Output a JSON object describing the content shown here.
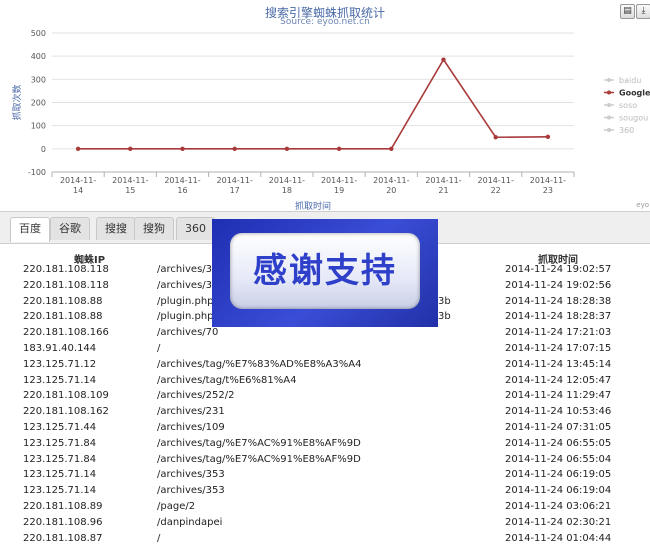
{
  "chart_data": {
    "type": "line",
    "title": "搜索引擎蜘蛛抓取统计",
    "subtitle": "Source: eyoo.net.cn",
    "xlabel": "抓取时间",
    "ylabel": "抓取次数",
    "categories": [
      "2014-11-14",
      "2014-11-15",
      "2014-11-16",
      "2014-11-17",
      "2014-11-18",
      "2014-11-19",
      "2014-11-20",
      "2014-11-21",
      "2014-11-22",
      "2014-11-23"
    ],
    "yticks": [
      -100,
      0,
      100,
      200,
      300,
      400,
      500
    ],
    "ylim": [
      -100,
      500
    ],
    "grid": true,
    "legend_position": "right",
    "series": [
      {
        "name": "baidu",
        "color": "#c8c8c8",
        "values": []
      },
      {
        "name": "Google",
        "color": "#a83a3a",
        "values": [
          0,
          0,
          0,
          0,
          0,
          0,
          0,
          385,
          50,
          52
        ]
      },
      {
        "name": "soso",
        "color": "#c8c8c8",
        "values": []
      },
      {
        "name": "sougou",
        "color": "#c8c8c8",
        "values": []
      },
      {
        "name": "360",
        "color": "#c8c8c8",
        "values": []
      }
    ]
  },
  "credit": "eyo",
  "toolbar": {
    "print_icon": "print-icon",
    "export_icon": "export-icon"
  },
  "tabs": [
    {
      "label": "百度",
      "active": true
    },
    {
      "label": "谷歌",
      "active": false
    },
    {
      "label": "搜搜",
      "active": false
    },
    {
      "label": "搜狗",
      "active": false
    },
    {
      "label": "360",
      "active": false
    }
  ],
  "table": {
    "headers": {
      "ip": "蜘蛛IP",
      "time": "抓取时间"
    },
    "rows": [
      {
        "ip": "220.181.108.118",
        "url": "/archives/3",
        "time": "2014-11-24 19:02:57"
      },
      {
        "ip": "220.181.108.118",
        "url": "/archives/3",
        "time": "2014-11-24 19:02:56"
      },
      {
        "ip": "220.181.108.88",
        "url": "/plugin.php",
        "tail": "3b",
        "time": "2014-11-24 18:28:38"
      },
      {
        "ip": "220.181.108.88",
        "url": "/plugin.php",
        "tail": "3b",
        "time": "2014-11-24 18:28:37"
      },
      {
        "ip": "220.181.108.166",
        "url": "/archives/70",
        "time": "2014-11-24 17:21:03"
      },
      {
        "ip": "183.91.40.144",
        "url": "/",
        "time": "2014-11-24 17:07:15"
      },
      {
        "ip": "123.125.71.12",
        "url": "/archives/tag/%E7%83%AD%E8%A3%A4",
        "time": "2014-11-24 13:45:14"
      },
      {
        "ip": "123.125.71.14",
        "url": "/archives/tag/t%E6%81%A4",
        "time": "2014-11-24 12:05:47"
      },
      {
        "ip": "220.181.108.109",
        "url": "/archives/252/2",
        "time": "2014-11-24 11:29:47"
      },
      {
        "ip": "220.181.108.162",
        "url": "/archives/231",
        "time": "2014-11-24 10:53:46"
      },
      {
        "ip": "123.125.71.44",
        "url": "/archives/109",
        "time": "2014-11-24 07:31:05"
      },
      {
        "ip": "123.125.71.84",
        "url": "/archives/tag/%E7%AC%91%E8%AF%9D",
        "time": "2014-11-24 06:55:05"
      },
      {
        "ip": "123.125.71.84",
        "url": "/archives/tag/%E7%AC%91%E8%AF%9D",
        "time": "2014-11-24 06:55:04"
      },
      {
        "ip": "123.125.71.14",
        "url": "/archives/353",
        "time": "2014-11-24 06:19:05"
      },
      {
        "ip": "123.125.71.14",
        "url": "/archives/353",
        "time": "2014-11-24 06:19:04"
      },
      {
        "ip": "220.181.108.89",
        "url": "/page/2",
        "time": "2014-11-24 03:06:21"
      },
      {
        "ip": "220.181.108.96",
        "url": "/danpindapei",
        "time": "2014-11-24 02:30:21"
      },
      {
        "ip": "220.181.108.87",
        "url": "/",
        "time": "2014-11-24 01:04:44"
      }
    ]
  },
  "overlay": {
    "text": "感谢支持",
    "colors": {
      "frame": "#2a3bc4",
      "text": "#2e3fc9"
    }
  }
}
